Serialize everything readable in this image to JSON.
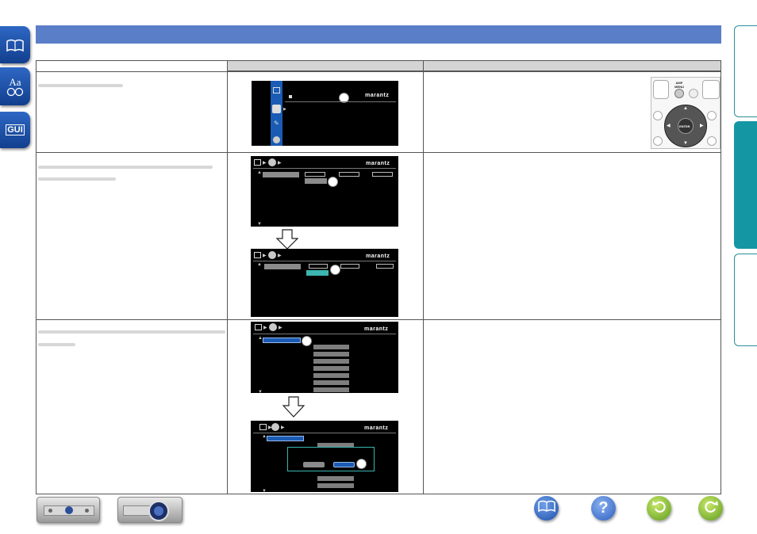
{
  "brand_text": "marantz",
  "remote": {
    "amp_menu_label": "AMP\nMENU",
    "enter_label": "ENTER"
  },
  "side_buttons": [
    {
      "icon": "book-icon"
    },
    {
      "icon": "glossary-icon",
      "label": "Aa"
    },
    {
      "icon": "gui-icon",
      "label": "GUI"
    }
  ],
  "right_tabs": [
    {
      "state": "inactive"
    },
    {
      "state": "active"
    },
    {
      "state": "inactive"
    }
  ],
  "bottom_nav": [
    {
      "icon": "book-icon",
      "label": ""
    },
    {
      "icon": "help-icon",
      "label": "?"
    },
    {
      "icon": "back-icon",
      "label": ""
    },
    {
      "icon": "forward-icon",
      "label": ""
    }
  ],
  "colors": {
    "title_bar": "#5b7ec8",
    "tab_active": "#1597a3",
    "gui_blue": "#1a5cb5",
    "gui_teal": "#3bb6b0"
  }
}
